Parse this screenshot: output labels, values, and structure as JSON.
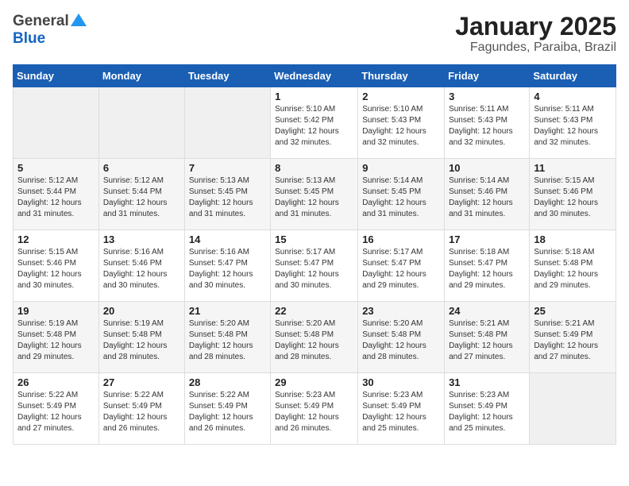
{
  "header": {
    "logo_general": "General",
    "logo_blue": "Blue",
    "title": "January 2025",
    "subtitle": "Fagundes, Paraiba, Brazil"
  },
  "weekdays": [
    "Sunday",
    "Monday",
    "Tuesday",
    "Wednesday",
    "Thursday",
    "Friday",
    "Saturday"
  ],
  "weeks": [
    [
      {
        "day": "",
        "detail": ""
      },
      {
        "day": "",
        "detail": ""
      },
      {
        "day": "",
        "detail": ""
      },
      {
        "day": "1",
        "detail": "Sunrise: 5:10 AM\nSunset: 5:42 PM\nDaylight: 12 hours\nand 32 minutes."
      },
      {
        "day": "2",
        "detail": "Sunrise: 5:10 AM\nSunset: 5:43 PM\nDaylight: 12 hours\nand 32 minutes."
      },
      {
        "day": "3",
        "detail": "Sunrise: 5:11 AM\nSunset: 5:43 PM\nDaylight: 12 hours\nand 32 minutes."
      },
      {
        "day": "4",
        "detail": "Sunrise: 5:11 AM\nSunset: 5:43 PM\nDaylight: 12 hours\nand 32 minutes."
      }
    ],
    [
      {
        "day": "5",
        "detail": "Sunrise: 5:12 AM\nSunset: 5:44 PM\nDaylight: 12 hours\nand 31 minutes."
      },
      {
        "day": "6",
        "detail": "Sunrise: 5:12 AM\nSunset: 5:44 PM\nDaylight: 12 hours\nand 31 minutes."
      },
      {
        "day": "7",
        "detail": "Sunrise: 5:13 AM\nSunset: 5:45 PM\nDaylight: 12 hours\nand 31 minutes."
      },
      {
        "day": "8",
        "detail": "Sunrise: 5:13 AM\nSunset: 5:45 PM\nDaylight: 12 hours\nand 31 minutes."
      },
      {
        "day": "9",
        "detail": "Sunrise: 5:14 AM\nSunset: 5:45 PM\nDaylight: 12 hours\nand 31 minutes."
      },
      {
        "day": "10",
        "detail": "Sunrise: 5:14 AM\nSunset: 5:46 PM\nDaylight: 12 hours\nand 31 minutes."
      },
      {
        "day": "11",
        "detail": "Sunrise: 5:15 AM\nSunset: 5:46 PM\nDaylight: 12 hours\nand 30 minutes."
      }
    ],
    [
      {
        "day": "12",
        "detail": "Sunrise: 5:15 AM\nSunset: 5:46 PM\nDaylight: 12 hours\nand 30 minutes."
      },
      {
        "day": "13",
        "detail": "Sunrise: 5:16 AM\nSunset: 5:46 PM\nDaylight: 12 hours\nand 30 minutes."
      },
      {
        "day": "14",
        "detail": "Sunrise: 5:16 AM\nSunset: 5:47 PM\nDaylight: 12 hours\nand 30 minutes."
      },
      {
        "day": "15",
        "detail": "Sunrise: 5:17 AM\nSunset: 5:47 PM\nDaylight: 12 hours\nand 30 minutes."
      },
      {
        "day": "16",
        "detail": "Sunrise: 5:17 AM\nSunset: 5:47 PM\nDaylight: 12 hours\nand 29 minutes."
      },
      {
        "day": "17",
        "detail": "Sunrise: 5:18 AM\nSunset: 5:47 PM\nDaylight: 12 hours\nand 29 minutes."
      },
      {
        "day": "18",
        "detail": "Sunrise: 5:18 AM\nSunset: 5:48 PM\nDaylight: 12 hours\nand 29 minutes."
      }
    ],
    [
      {
        "day": "19",
        "detail": "Sunrise: 5:19 AM\nSunset: 5:48 PM\nDaylight: 12 hours\nand 29 minutes."
      },
      {
        "day": "20",
        "detail": "Sunrise: 5:19 AM\nSunset: 5:48 PM\nDaylight: 12 hours\nand 28 minutes."
      },
      {
        "day": "21",
        "detail": "Sunrise: 5:20 AM\nSunset: 5:48 PM\nDaylight: 12 hours\nand 28 minutes."
      },
      {
        "day": "22",
        "detail": "Sunrise: 5:20 AM\nSunset: 5:48 PM\nDaylight: 12 hours\nand 28 minutes."
      },
      {
        "day": "23",
        "detail": "Sunrise: 5:20 AM\nSunset: 5:48 PM\nDaylight: 12 hours\nand 28 minutes."
      },
      {
        "day": "24",
        "detail": "Sunrise: 5:21 AM\nSunset: 5:48 PM\nDaylight: 12 hours\nand 27 minutes."
      },
      {
        "day": "25",
        "detail": "Sunrise: 5:21 AM\nSunset: 5:49 PM\nDaylight: 12 hours\nand 27 minutes."
      }
    ],
    [
      {
        "day": "26",
        "detail": "Sunrise: 5:22 AM\nSunset: 5:49 PM\nDaylight: 12 hours\nand 27 minutes."
      },
      {
        "day": "27",
        "detail": "Sunrise: 5:22 AM\nSunset: 5:49 PM\nDaylight: 12 hours\nand 26 minutes."
      },
      {
        "day": "28",
        "detail": "Sunrise: 5:22 AM\nSunset: 5:49 PM\nDaylight: 12 hours\nand 26 minutes."
      },
      {
        "day": "29",
        "detail": "Sunrise: 5:23 AM\nSunset: 5:49 PM\nDaylight: 12 hours\nand 26 minutes."
      },
      {
        "day": "30",
        "detail": "Sunrise: 5:23 AM\nSunset: 5:49 PM\nDaylight: 12 hours\nand 25 minutes."
      },
      {
        "day": "31",
        "detail": "Sunrise: 5:23 AM\nSunset: 5:49 PM\nDaylight: 12 hours\nand 25 minutes."
      },
      {
        "day": "",
        "detail": ""
      }
    ]
  ]
}
